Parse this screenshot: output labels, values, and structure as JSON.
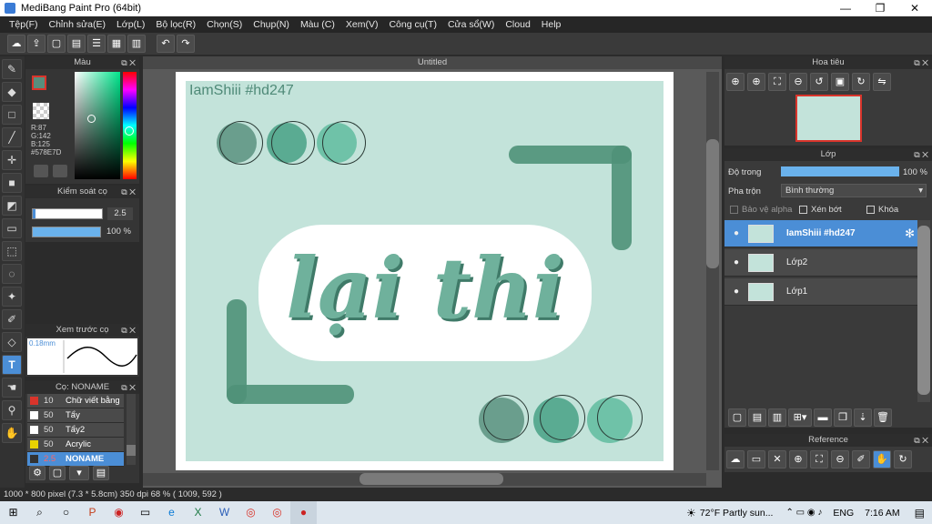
{
  "window": {
    "title": "MediBang Paint Pro (64bit)",
    "minimize": "—",
    "restore": "❐",
    "close": "✕"
  },
  "menu": [
    "Tệp(F)",
    "Chỉnh sửa(E)",
    "Lớp(L)",
    "Bộ lọc(R)",
    "Chọn(S)",
    "Chụp(N)",
    "Màu (C)",
    "Xem(V)",
    "Công cụ(T)",
    "Cửa sổ(W)",
    "Cloud",
    "Help"
  ],
  "color_panel": {
    "title": "Màu",
    "r": "R:87",
    "g": "G:142",
    "b": "B:125",
    "hex": "#578E7D",
    "primary_color": "#578E7D",
    "secondary_color": "#FFFFFF"
  },
  "brush_control": {
    "title": "Kiểm soát cọ",
    "size": "2.5",
    "opacity": "100 %"
  },
  "brush_preview": {
    "title": "Xem trước cọ",
    "size": "0.18mm"
  },
  "brush_list": {
    "title": "Cọ: NONAME",
    "items": [
      {
        "size": "10",
        "name": "Chữ viết bằng",
        "swatch": "#d9342b"
      },
      {
        "size": "50",
        "name": "Tẩy",
        "swatch": "#ffffff"
      },
      {
        "size": "50",
        "name": "Tẩy2",
        "swatch": "#ffffff"
      },
      {
        "size": "50",
        "name": "Acrylic",
        "swatch": "#e8d200"
      },
      {
        "size": "2.5",
        "name": "NONAME",
        "swatch": "#333333"
      }
    ]
  },
  "document": {
    "tab": "Untitled",
    "layer_text": "IamShiii #hd247",
    "art_text": "lại thi",
    "bg_color": "#c3e3da",
    "accent_color": "#578E7D"
  },
  "navigator": {
    "title": "Hoa tiêu"
  },
  "layers_panel": {
    "title": "Lớp",
    "opacity_label": "Độ trong",
    "opacity_value": "100 %",
    "blend_label": "Pha trộn",
    "blend_value": "Bình thường",
    "protect_alpha": "Bảo vệ alpha",
    "clipping": "Xén bớt",
    "lock": "Khóa",
    "layers": [
      {
        "name": "IamShiii #hd247",
        "selected": true
      },
      {
        "name": "Lớp2",
        "selected": false
      },
      {
        "name": "Lớp1",
        "selected": false
      }
    ]
  },
  "reference": {
    "title": "Reference"
  },
  "status": "1000 * 800 pixel  (7.3 * 5.8cm)  350 dpi  68 %  ( 1009, 592 )",
  "taskbar": {
    "weather": "72°F  Partly sun...",
    "lang": "ENG",
    "time": "7:16 AM"
  }
}
